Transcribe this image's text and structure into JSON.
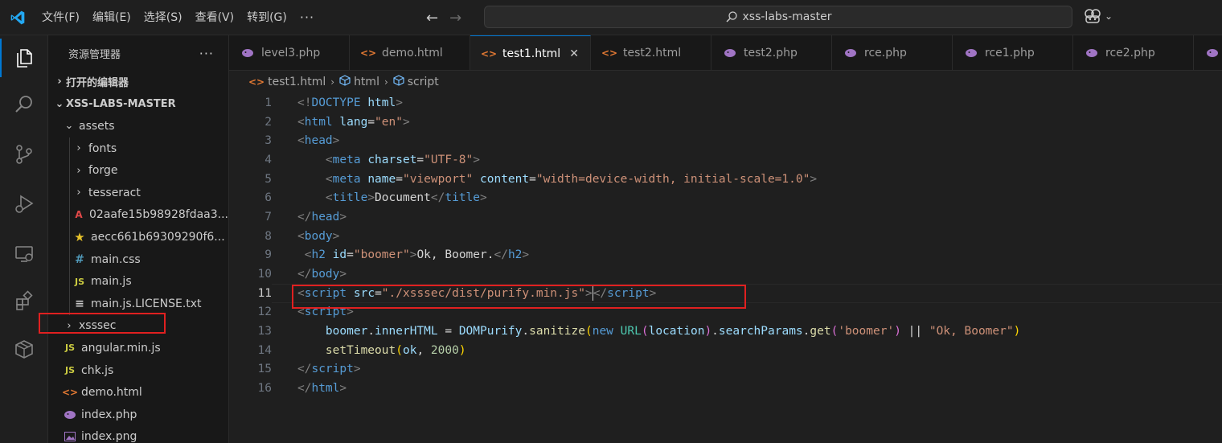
{
  "titlebar": {
    "menu": [
      "文件(F)",
      "编辑(E)",
      "选择(S)",
      "查看(V)",
      "转到(G)"
    ],
    "more": "···",
    "search": "xss-labs-master"
  },
  "sidebar": {
    "title": "资源管理器",
    "more": "···",
    "open_editors": "打开的编辑器",
    "root": "XSS-LABS-MASTER",
    "items": [
      {
        "label": "assets",
        "kind": "folder-open",
        "depth": 1
      },
      {
        "label": "fonts",
        "kind": "folder",
        "depth": 2
      },
      {
        "label": "forge",
        "kind": "folder",
        "depth": 2
      },
      {
        "label": "tesseract",
        "kind": "folder",
        "depth": 2
      },
      {
        "label": "02aafe15b98928fdaa3...",
        "kind": "font",
        "depth": 2
      },
      {
        "label": "aecc661b69309290f6...",
        "kind": "star",
        "depth": 2
      },
      {
        "label": "main.css",
        "kind": "css",
        "depth": 2
      },
      {
        "label": "main.js",
        "kind": "js",
        "depth": 2
      },
      {
        "label": "main.js.LICENSE.txt",
        "kind": "txt",
        "depth": 2
      },
      {
        "label": "xsssec",
        "kind": "folder",
        "depth": 1
      },
      {
        "label": "angular.min.js",
        "kind": "js",
        "depth": 1
      },
      {
        "label": "chk.js",
        "kind": "js",
        "depth": 1
      },
      {
        "label": "demo.html",
        "kind": "html",
        "depth": 1
      },
      {
        "label": "index.php",
        "kind": "php",
        "depth": 1
      },
      {
        "label": "index.png",
        "kind": "img",
        "depth": 1
      }
    ]
  },
  "tabs": [
    {
      "label": "level3.php",
      "kind": "php"
    },
    {
      "label": "demo.html",
      "kind": "html"
    },
    {
      "label": "test1.html",
      "kind": "html",
      "active": true
    },
    {
      "label": "test2.html",
      "kind": "html"
    },
    {
      "label": "test2.php",
      "kind": "php"
    },
    {
      "label": "rce.php",
      "kind": "php"
    },
    {
      "label": "rce1.php",
      "kind": "php"
    },
    {
      "label": "rce2.php",
      "kind": "php"
    },
    {
      "label": "",
      "kind": "php"
    }
  ],
  "breadcrumb": {
    "file": "test1.html",
    "node1": "html",
    "node2": "script"
  },
  "editor": {
    "current_line": 11,
    "lines": [
      [
        [
          "t-br",
          "<!"
        ],
        [
          "t-tag",
          "DOCTYPE"
        ],
        [
          "t-txt",
          " "
        ],
        [
          "t-attr",
          "html"
        ],
        [
          "t-br",
          ">"
        ]
      ],
      [
        [
          "t-br",
          "<"
        ],
        [
          "t-tag",
          "html"
        ],
        [
          "t-txt",
          " "
        ],
        [
          "t-attr",
          "lang"
        ],
        [
          "t-txt",
          "="
        ],
        [
          "t-str",
          "\"en\""
        ],
        [
          "t-br",
          ">"
        ]
      ],
      [
        [
          "t-br",
          "<"
        ],
        [
          "t-tag",
          "head"
        ],
        [
          "t-br",
          ">"
        ]
      ],
      [
        [
          "t-txt",
          "    "
        ],
        [
          "t-br",
          "<"
        ],
        [
          "t-tag",
          "meta"
        ],
        [
          "t-txt",
          " "
        ],
        [
          "t-attr",
          "charset"
        ],
        [
          "t-txt",
          "="
        ],
        [
          "t-str",
          "\"UTF-8\""
        ],
        [
          "t-br",
          ">"
        ]
      ],
      [
        [
          "t-txt",
          "    "
        ],
        [
          "t-br",
          "<"
        ],
        [
          "t-tag",
          "meta"
        ],
        [
          "t-txt",
          " "
        ],
        [
          "t-attr",
          "name"
        ],
        [
          "t-txt",
          "="
        ],
        [
          "t-str",
          "\"viewport\""
        ],
        [
          "t-txt",
          " "
        ],
        [
          "t-attr",
          "content"
        ],
        [
          "t-txt",
          "="
        ],
        [
          "t-str",
          "\"width=device-width, initial-scale=1.0\""
        ],
        [
          "t-br",
          ">"
        ]
      ],
      [
        [
          "t-txt",
          "    "
        ],
        [
          "t-br",
          "<"
        ],
        [
          "t-tag",
          "title"
        ],
        [
          "t-br",
          ">"
        ],
        [
          "t-txt",
          "Document"
        ],
        [
          "t-br",
          "</"
        ],
        [
          "t-tag",
          "title"
        ],
        [
          "t-br",
          ">"
        ]
      ],
      [
        [
          "t-br",
          "</"
        ],
        [
          "t-tag",
          "head"
        ],
        [
          "t-br",
          ">"
        ]
      ],
      [
        [
          "t-br",
          "<"
        ],
        [
          "t-tag",
          "body"
        ],
        [
          "t-br",
          ">"
        ]
      ],
      [
        [
          "t-txt",
          " "
        ],
        [
          "t-br",
          "<"
        ],
        [
          "t-tag",
          "h2"
        ],
        [
          "t-txt",
          " "
        ],
        [
          "t-attr",
          "id"
        ],
        [
          "t-txt",
          "="
        ],
        [
          "t-str",
          "\"boomer\""
        ],
        [
          "t-br",
          ">"
        ],
        [
          "t-txt",
          "Ok, Boomer."
        ],
        [
          "t-br",
          "</"
        ],
        [
          "t-tag",
          "h2"
        ],
        [
          "t-br",
          ">"
        ]
      ],
      [
        [
          "t-br",
          "</"
        ],
        [
          "t-tag",
          "body"
        ],
        [
          "t-br",
          ">"
        ]
      ],
      [
        [
          "t-br",
          "<"
        ],
        [
          "t-tag",
          "script"
        ],
        [
          "t-txt",
          " "
        ],
        [
          "t-attr",
          "src"
        ],
        [
          "t-txt",
          "="
        ],
        [
          "t-str",
          "\"./xsssec/dist/purify.min.js\""
        ],
        [
          "t-br",
          ">"
        ],
        [
          "cursor",
          ""
        ],
        [
          "t-br",
          "</"
        ],
        [
          "t-tag",
          "script"
        ],
        [
          "t-br",
          ">"
        ]
      ],
      [
        [
          "t-br",
          "<"
        ],
        [
          "t-tag",
          "script"
        ],
        [
          "t-br",
          ">"
        ]
      ],
      [
        [
          "t-txt",
          "    "
        ],
        [
          "t-var",
          "boomer"
        ],
        [
          "t-txt",
          "."
        ],
        [
          "t-var",
          "innerHTML"
        ],
        [
          "t-txt",
          " = "
        ],
        [
          "t-var",
          "DOMPurify"
        ],
        [
          "t-txt",
          "."
        ],
        [
          "t-fn",
          "sanitize"
        ],
        [
          "t-p1",
          "("
        ],
        [
          "t-kw",
          "new"
        ],
        [
          "t-txt",
          " "
        ],
        [
          "t-cls",
          "URL"
        ],
        [
          "t-p2",
          "("
        ],
        [
          "t-var",
          "location"
        ],
        [
          "t-p2",
          ")"
        ],
        [
          "t-txt",
          "."
        ],
        [
          "t-var",
          "searchParams"
        ],
        [
          "t-txt",
          "."
        ],
        [
          "t-fn",
          "get"
        ],
        [
          "t-p2",
          "("
        ],
        [
          "t-str",
          "'boomer'"
        ],
        [
          "t-p2",
          ")"
        ],
        [
          "t-txt",
          " || "
        ],
        [
          "t-str",
          "\"Ok, Boomer\""
        ],
        [
          "t-p1",
          ")"
        ]
      ],
      [
        [
          "t-txt",
          "    "
        ],
        [
          "t-fn",
          "setTimeout"
        ],
        [
          "t-p1",
          "("
        ],
        [
          "t-var",
          "ok"
        ],
        [
          "t-txt",
          ", "
        ],
        [
          "t-num",
          "2000"
        ],
        [
          "t-p1",
          ")"
        ]
      ],
      [
        [
          "t-br",
          "</"
        ],
        [
          "t-tag",
          "script"
        ],
        [
          "t-br",
          ">"
        ]
      ],
      [
        [
          "t-br",
          "</"
        ],
        [
          "t-tag",
          "html"
        ],
        [
          "t-br",
          ">"
        ]
      ]
    ]
  },
  "colors": {
    "accent": "#0078d4",
    "highlight": "#e02020",
    "php": "#a074c4",
    "html": "#e37933",
    "js": "#cbcb41",
    "css": "#519aba"
  }
}
